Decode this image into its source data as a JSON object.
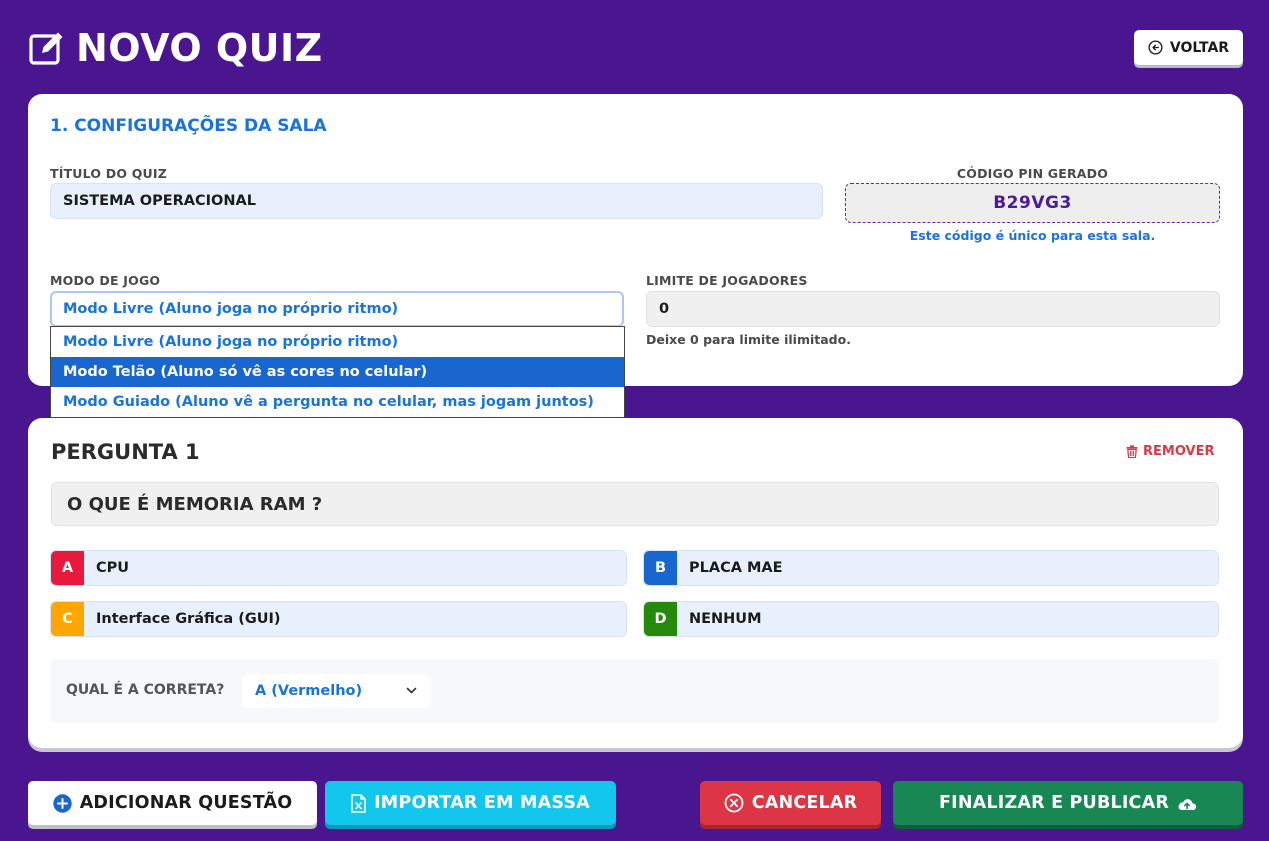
{
  "header": {
    "title": "NOVO QUIZ",
    "back_label": "VOLTAR"
  },
  "settings": {
    "section_title": "1. CONFIGURAÇÕES DA SALA",
    "quiz_title_label": "TÍTULO DO QUIZ",
    "quiz_title_value": "SISTEMA OPERACIONAL",
    "pin_label": "CÓDIGO PIN GERADO",
    "pin_value": "B29VG3",
    "pin_help": "Este código é único para esta sala.",
    "mode_label": "MODO DE JOGO",
    "mode_selected": "Modo Livre (Aluno joga no próprio ritmo)",
    "mode_options": [
      "Modo Livre (Aluno joga no próprio ritmo)",
      "Modo Telão (Aluno só vê as cores no celular)",
      "Modo Guiado (Aluno vê a pergunta no celular, mas jogam juntos)"
    ],
    "mode_highlighted_index": 1,
    "player_limit_label": "LIMITE DE JOGADORES",
    "player_limit_value": "0",
    "player_limit_help": "Deixe 0 para limite ilimitado."
  },
  "question": {
    "title": "PERGUNTA 1",
    "remove_label": "REMOVER",
    "text": "O QUE É MEMORIA RAM ?",
    "answers": [
      {
        "letter": "A",
        "text": "CPU",
        "color": "#e8193c"
      },
      {
        "letter": "B",
        "text": "PLACA MAE",
        "color": "#1a66cf"
      },
      {
        "letter": "C",
        "text": "Interface Gráfica (GUI)",
        "color": "#ffa602"
      },
      {
        "letter": "D",
        "text": "NENHUM",
        "color": "#26890c"
      }
    ],
    "correct_label": "QUAL É A CORRETA?",
    "correct_value": "A (Vermelho)"
  },
  "footer": {
    "add_label": "ADICIONAR QUESTÃO",
    "import_label": "IMPORTAR EM MASSA",
    "cancel_label": "CANCELAR",
    "publish_label": "FINALIZAR E PUBLICAR"
  },
  "icons": {
    "title": "pencil-square-icon",
    "back": "arrow-left-circle-icon",
    "remove": "trash-icon",
    "add": "plus-circle-icon",
    "import": "file-excel-icon",
    "cancel": "x-circle-icon",
    "publish": "cloud-upload-icon"
  }
}
